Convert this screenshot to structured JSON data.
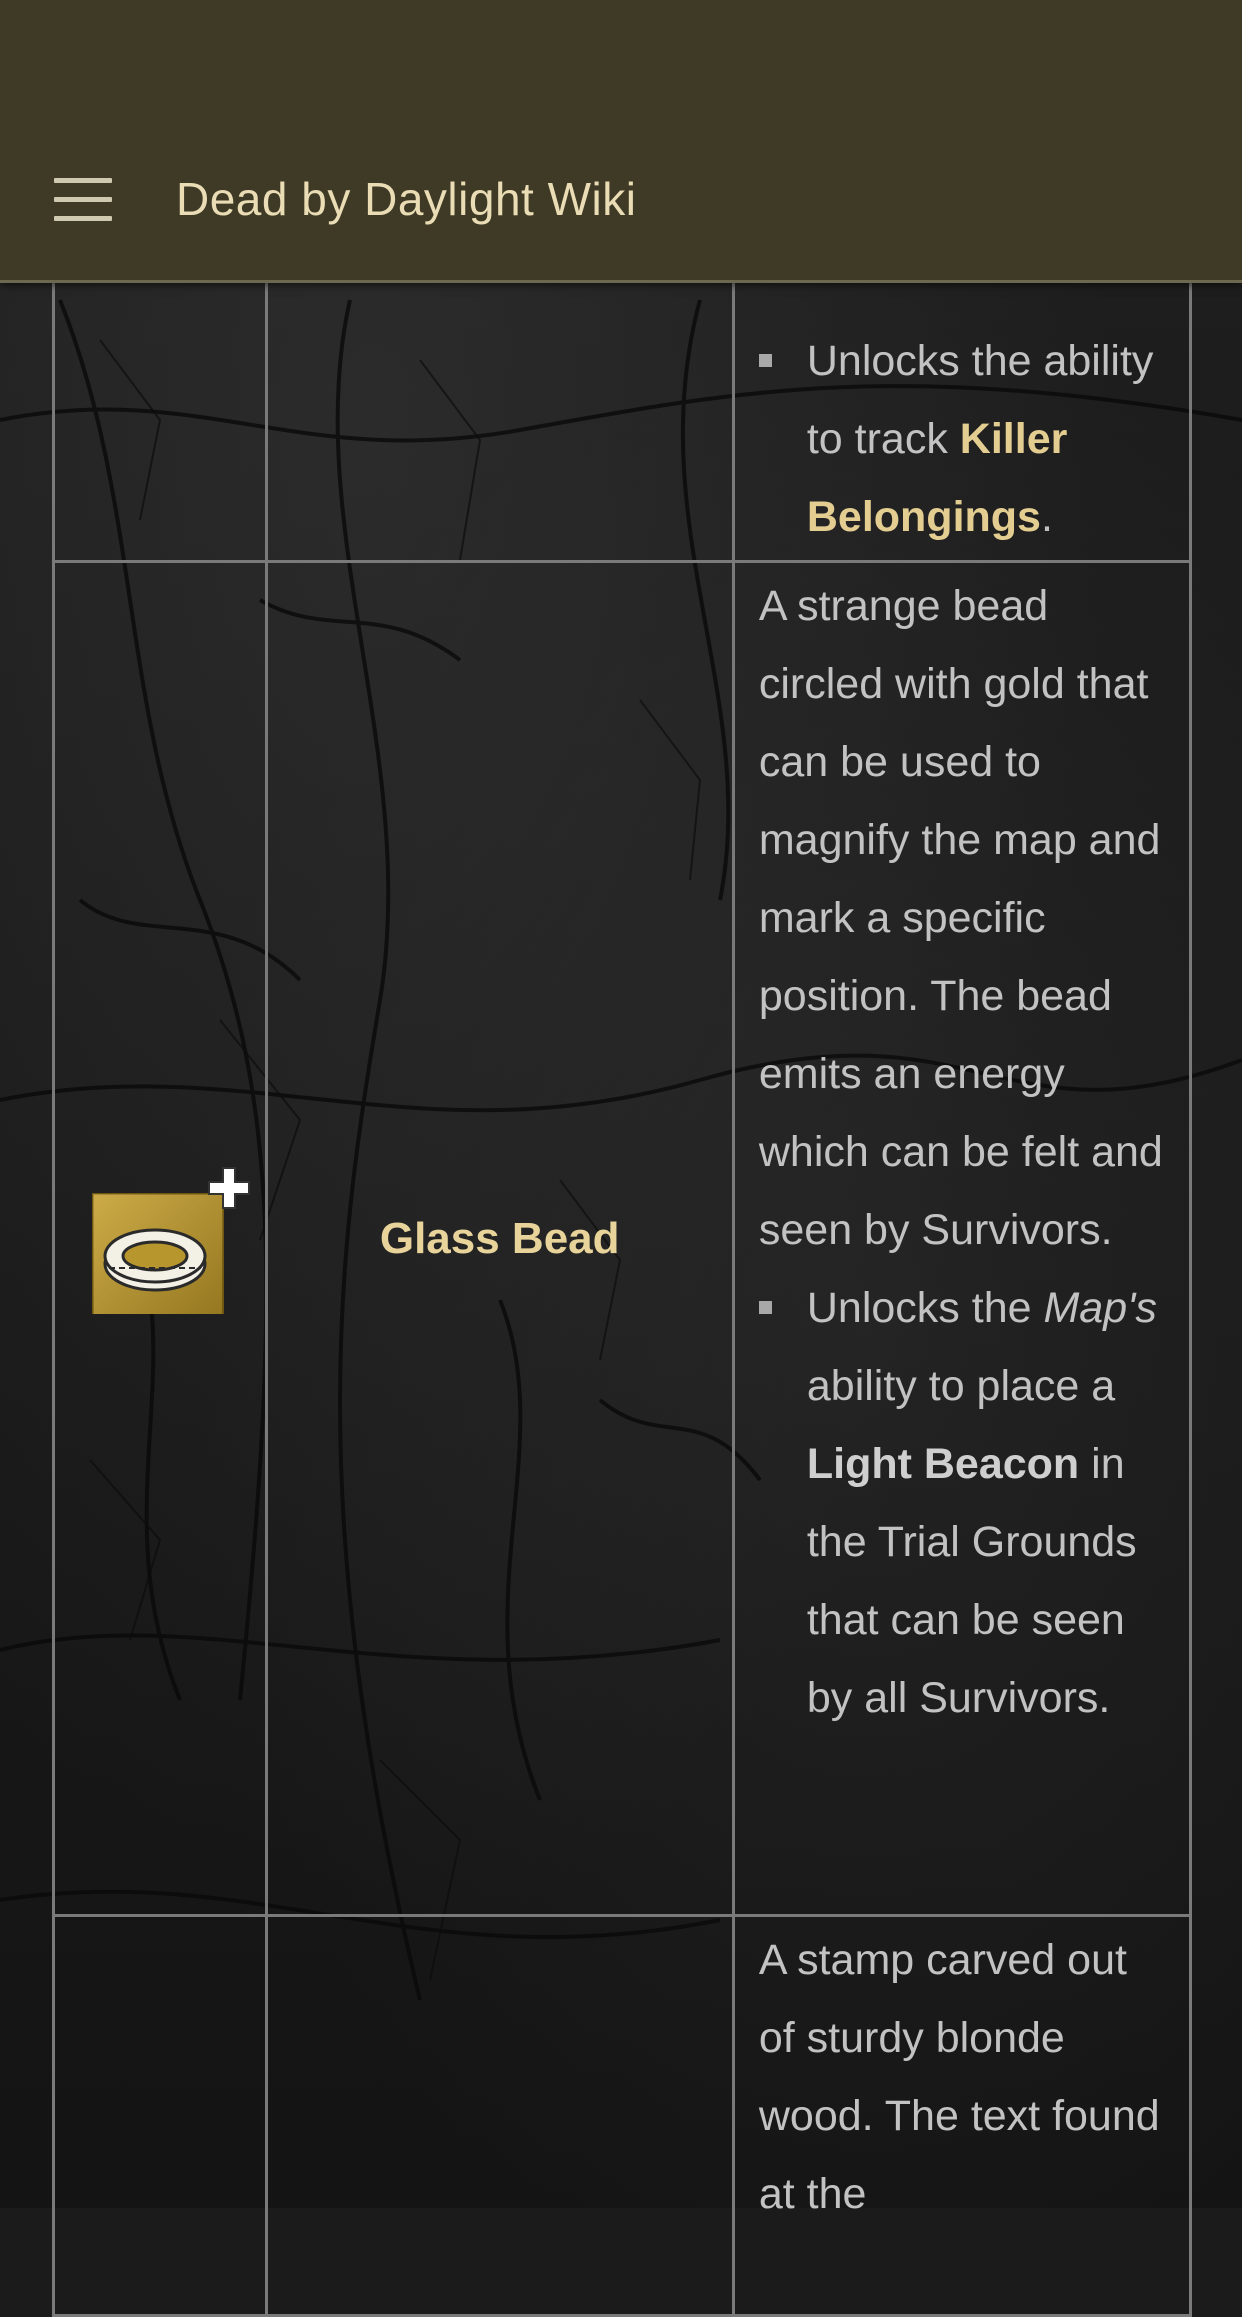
{
  "header": {
    "site_title": "Dead by Daylight Wiki",
    "menu_icon": "hamburger-menu-icon"
  },
  "rows": [
    {
      "name": "",
      "bullets": [
        {
          "prefix": "Unlocks the ability to track ",
          "link": "Killer Belongings",
          "suffix": "."
        }
      ]
    },
    {
      "icon": "glass-bead-addon-icon",
      "icon_colors": {
        "tile": "#b8962e",
        "plus": "#ffffff"
      },
      "name": "Glass Bead",
      "description": "A strange bead circled with gold that can be used to magnify the map and mark a specific position. The bead emits an energy which can be felt and seen by Survivors.",
      "bullet": {
        "part1": "Unlocks the",
        "italic": "Map's",
        "part2": " ability to place a ",
        "bold": "Light Beacon",
        "part3": " in the Trial Grounds that can be seen by all Survivors."
      }
    },
    {
      "name": "",
      "description": "A stamp carved out of sturdy blonde wood. The text found at the"
    }
  ],
  "colors": {
    "header_bg": "#3e3a25",
    "title_text": "#eadcb4",
    "link_gold": "#e3cd90",
    "body_text": "#c2c2c2",
    "border": "#7a7a7a"
  }
}
